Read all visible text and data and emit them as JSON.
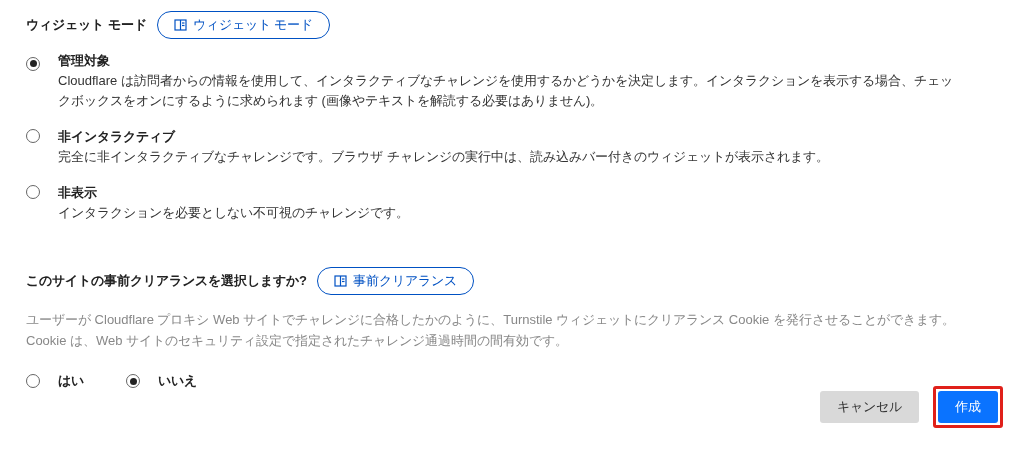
{
  "widget_mode": {
    "heading": "ウィジェット モード",
    "doc_link": "ウィジェット モード",
    "options": [
      {
        "label": "管理対象",
        "description": "Cloudflare は訪問者からの情報を使用して、インタラクティブなチャレンジを使用するかどうかを決定します。インタラクションを表示する場合、チェックボックスをオンにするように求められます (画像やテキストを解読する必要はありません)。",
        "selected": true
      },
      {
        "label": "非インタラクティブ",
        "description": "完全に非インタラクティブなチャレンジです。ブラウザ チャレンジの実行中は、読み込みバー付きのウィジェットが表示されます。",
        "selected": false
      },
      {
        "label": "非表示",
        "description": "インタラクションを必要としない不可視のチャレンジです。",
        "selected": false
      }
    ]
  },
  "pre_clearance": {
    "heading": "このサイトの事前クリアランスを選択しますか?",
    "doc_link": "事前クリアランス",
    "description": "ユーザーが Cloudflare プロキシ Web サイトでチャレンジに合格したかのように、Turnstile ウィジェットにクリアランス Cookie を発行させることができます。Cookie は、Web サイトのセキュリティ設定で指定されたチャレンジ通過時間の間有効です。",
    "options": [
      {
        "label": "はい",
        "selected": false
      },
      {
        "label": "いいえ",
        "selected": true
      }
    ]
  },
  "buttons": [
    {
      "label": "キャンセル",
      "kind": "secondary",
      "highlighted": false
    },
    {
      "label": "作成",
      "kind": "primary",
      "highlighted": true
    }
  ]
}
